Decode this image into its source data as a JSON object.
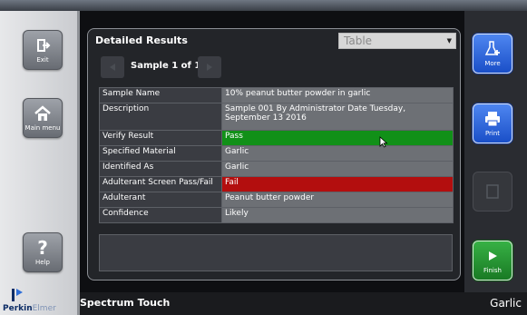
{
  "left_rail": {
    "exit_label": "Exit",
    "main_menu_label": "Main menu",
    "help_label": "Help"
  },
  "right_rail": {
    "more_label": "More",
    "print_label": "Print",
    "finish_label": "Finish"
  },
  "panel": {
    "title": "Detailed Results",
    "view_select": "Table",
    "sample_nav": "Sample 1 of 1"
  },
  "results": [
    {
      "label": "Sample Name",
      "value": "10% peanut butter powder in garlic"
    },
    {
      "label": "Description",
      "value": "Sample 001 By Administrator Date Tuesday, September 13 2016"
    },
    {
      "label": "Verify Result",
      "value": "Pass"
    },
    {
      "label": "Specified Material",
      "value": "Garlic"
    },
    {
      "label": "Identified As",
      "value": "Garlic"
    },
    {
      "label": "Adulterant Screen Pass/Fail",
      "value": "Fail"
    },
    {
      "label": "Adulterant",
      "value": "Peanut butter powder"
    },
    {
      "label": "Confidence",
      "value": "Likely"
    }
  ],
  "status_colors": {
    "pass": "#119018",
    "fail": "#b30e0e"
  },
  "footer": {
    "app_name": "Spectrum Touch",
    "material": "Garlic"
  },
  "logo": {
    "brand_strong": "Perkin",
    "brand_light": "Elmer"
  },
  "icons": [
    "exit-icon",
    "home-icon",
    "help-icon",
    "more-icon",
    "print-icon",
    "disabled-icon",
    "finish-arrow-icon",
    "prev-arrow-icon",
    "next-arrow-icon",
    "dropdown-caret-icon",
    "cursor-icon"
  ]
}
